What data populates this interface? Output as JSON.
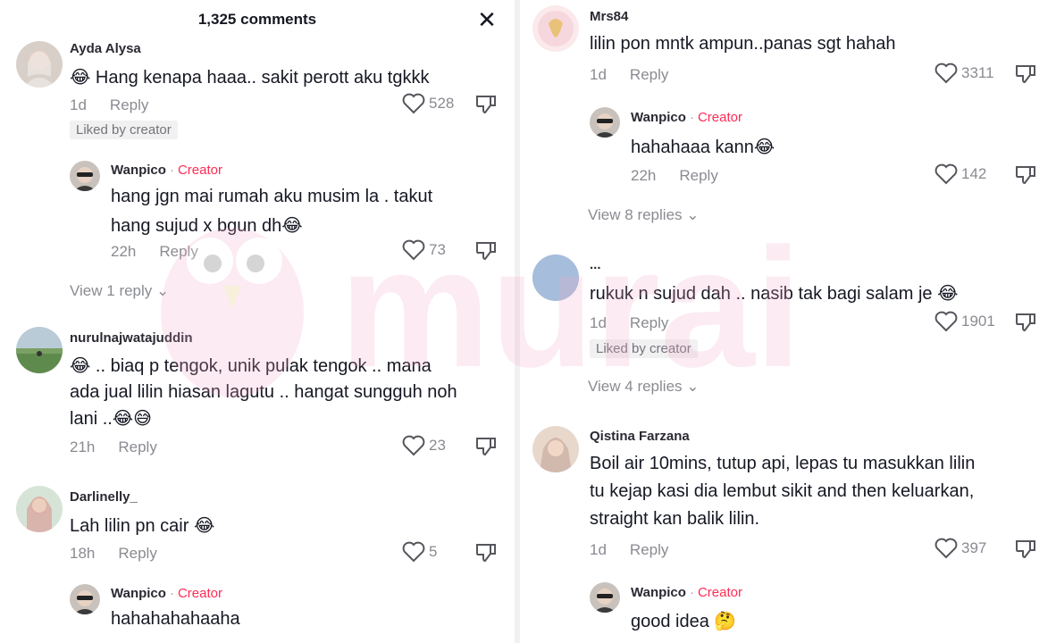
{
  "header": {
    "title": "1,325 comments",
    "close_icon": "close-icon"
  },
  "watermark": {
    "text": "murai"
  },
  "left": [
    {
      "user": "Ayda Alysa",
      "text": [
        "😂 Hang kenapa haaa.. sakit perott aku tgkkk"
      ],
      "time": "1d",
      "reply": "Reply",
      "likes": "528",
      "liked_by": "Liked by creator"
    },
    {
      "user": "Wanpico",
      "creator": "Creator",
      "text": [
        "hang jgn mai rumah aku musim la . takut",
        "hang sujud x bgun dh😂"
      ],
      "time": "22h",
      "reply": "Reply",
      "likes": "73"
    },
    {
      "view_replies": "View 1 reply"
    },
    {
      "user": "nurulnajwatajuddin",
      "text": [
        "😂 .. biaq p tengok, unik pulak tengok .. mana",
        "ada jual lilin hiasan lagutu .. hangat sungguh noh",
        "lani ..😂😅"
      ],
      "time": "21h",
      "reply": "Reply",
      "likes": "23"
    },
    {
      "user": "Darlinelly_",
      "text": [
        "Lah lilin pn cair 😂"
      ],
      "time": "18h",
      "reply": "Reply",
      "likes": "5"
    },
    {
      "user": "Wanpico",
      "creator": "Creator",
      "text": [
        "hahahahahaaha"
      ]
    }
  ],
  "right": [
    {
      "user": "Mrs84",
      "text": [
        "lilin pon mntk ampun..panas sgt hahah"
      ],
      "time": "1d",
      "reply": "Reply",
      "likes": "3311"
    },
    {
      "user": "Wanpico",
      "creator": "Creator",
      "text": [
        "hahahaaa kann😂"
      ],
      "time": "22h",
      "reply": "Reply",
      "likes": "142"
    },
    {
      "view_replies": "View 8 replies"
    },
    {
      "user": "...",
      "text": [
        "rukuk n sujud dah .. nasib tak bagi salam je 😂"
      ],
      "time": "1d",
      "reply": "Reply",
      "likes": "1901",
      "liked_by": "Liked by creator"
    },
    {
      "view_replies": "View 4 replies"
    },
    {
      "user": "Qistina Farzana",
      "text": [
        "Boil air 10mins, tutup api, lepas tu masukkan lilin",
        "tu kejap kasi dia lembut sikit and then keluarkan,",
        "straight kan balik lilin."
      ],
      "time": "1d",
      "reply": "Reply",
      "likes": "397"
    },
    {
      "user": "Wanpico",
      "creator": "Creator",
      "text": [
        "good idea 🤔"
      ]
    }
  ],
  "colors": {
    "creator": "#fe2c55",
    "muted": "#8a8b91",
    "text": "#161823",
    "badge_bg": "#f1f1f2"
  }
}
